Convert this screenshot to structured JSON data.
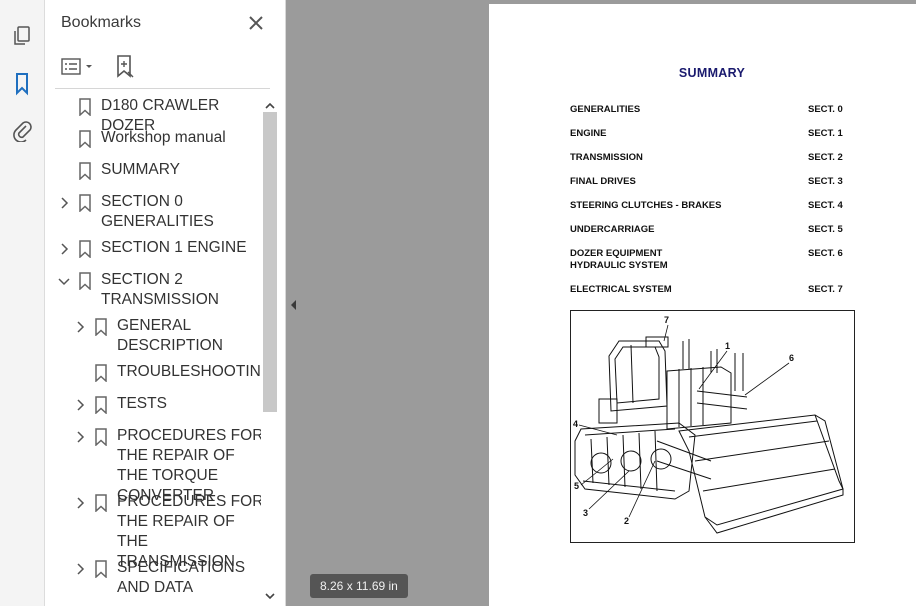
{
  "panel": {
    "title": "Bookmarks"
  },
  "bookmarks": [
    {
      "label": "D180 CRAWLER DOZER",
      "expandable": false,
      "expanded": false
    },
    {
      "label": "Workshop manual",
      "expandable": false,
      "expanded": false
    },
    {
      "label": "SUMMARY",
      "expandable": false,
      "expanded": false
    },
    {
      "label": "SECTION 0 GENERALITIES",
      "expandable": true,
      "expanded": false
    },
    {
      "label": "SECTION 1 ENGINE",
      "expandable": true,
      "expanded": false
    },
    {
      "label": "SECTION 2 TRANSMISSION",
      "expandable": true,
      "expanded": true
    },
    {
      "label": "GENERAL DESCRIPTION",
      "expandable": true,
      "expanded": false
    },
    {
      "label": "TROUBLESHOOTING",
      "expandable": false,
      "expanded": false
    },
    {
      "label": "TESTS",
      "expandable": true,
      "expanded": false
    },
    {
      "label": "PROCEDURES FOR THE REPAIR OF THE TORQUE CONVERTER",
      "expandable": true,
      "expanded": false
    },
    {
      "label": "PROCEDURES FOR THE REPAIR OF THE TRANSMISSION",
      "expandable": true,
      "expanded": false
    },
    {
      "label": "SPECIFICATIONS AND DATA",
      "expandable": true,
      "expanded": false
    }
  ],
  "status": {
    "page_size": "8.26 x 11.69 in"
  },
  "document": {
    "title": "SUMMARY",
    "toc": [
      {
        "name": "GENERALITIES",
        "section": "SECT. 0"
      },
      {
        "name": "ENGINE",
        "section": "SECT. 1"
      },
      {
        "name": "TRANSMISSION",
        "section": "SECT. 2"
      },
      {
        "name": "FINAL DRIVES",
        "section": "SECT. 3"
      },
      {
        "name": "STEERING CLUTCHES - BRAKES",
        "section": "SECT. 4"
      },
      {
        "name": "UNDERCARRIAGE",
        "section": "SECT. 5"
      },
      {
        "name": "DOZER EQUIPMENT\nHYDRAULIC SYSTEM",
        "section": "SECT. 6"
      },
      {
        "name": "ELECTRICAL SYSTEM",
        "section": "SECT. 7"
      }
    ],
    "figure_callouts": [
      "1",
      "2",
      "3",
      "4",
      "5",
      "6",
      "7"
    ]
  },
  "icons": {
    "rail": [
      "pages-icon",
      "bookmark-icon",
      "attachment-icon"
    ],
    "accent": "#1f6fbf"
  }
}
